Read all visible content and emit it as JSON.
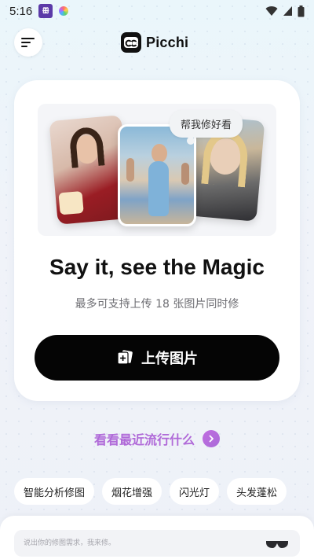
{
  "status_bar": {
    "time": "5:16",
    "app_icon_label": "ꕥ",
    "icons": [
      "wifi-icon",
      "cell-signal-icon",
      "battery-icon"
    ]
  },
  "header": {
    "brand_name": "Picchi",
    "logo_text": "cc"
  },
  "hero": {
    "bubble_text": "帮我修好看",
    "title": "Say it, see the Magic",
    "subtitle": "最多可支持上传 18 张图片同时修",
    "upload_label": "上传图片"
  },
  "trending": {
    "label": "看看最近流行什么"
  },
  "chips": [
    {
      "label": "智能分析修图"
    },
    {
      "label": "烟花增强"
    },
    {
      "label": "闪光灯"
    },
    {
      "label": "头发蓬松"
    }
  ],
  "prompt": {
    "placeholder": "说出你的修图需求，我来修。"
  },
  "colors": {
    "accent_purple": "#b06ad8",
    "button_black": "#050505"
  }
}
